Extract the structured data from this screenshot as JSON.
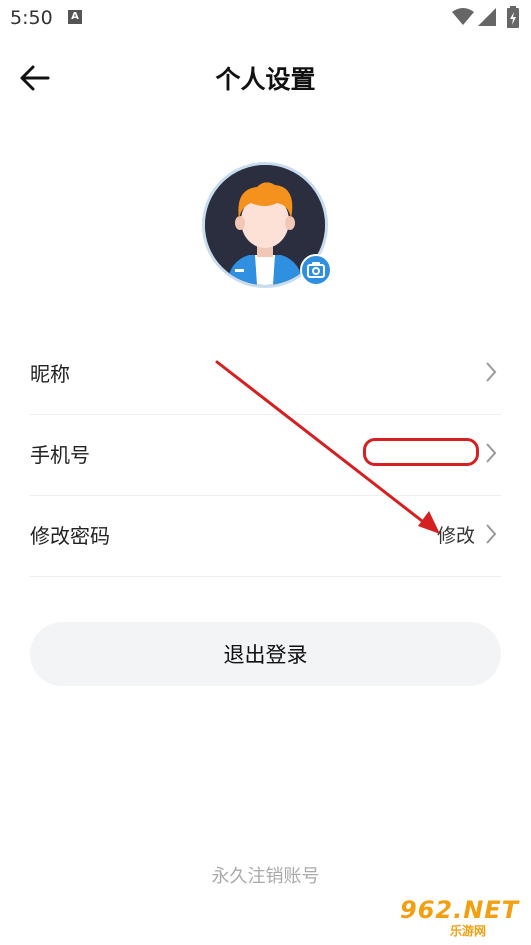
{
  "status_bar": {
    "time": "5:50",
    "notif_letter": "A"
  },
  "header": {
    "title": "个人设置"
  },
  "settings": [
    {
      "label": "昵称",
      "value": ""
    },
    {
      "label": "手机号",
      "value": ""
    },
    {
      "label": "修改密码",
      "value": "修改"
    }
  ],
  "logout_label": "退出登录",
  "cancel_account_label": "永久注销账号",
  "watermark": {
    "brand": "962.NET",
    "sub": "乐游网"
  },
  "colors": {
    "accent": "#2f8fe0",
    "annotation": "#d42020",
    "button_bg": "#f3f4f6"
  },
  "icons": [
    "back-arrow-icon",
    "camera-icon",
    "chevron-right-icon",
    "wifi-icon",
    "signal-icon",
    "battery-icon"
  ]
}
